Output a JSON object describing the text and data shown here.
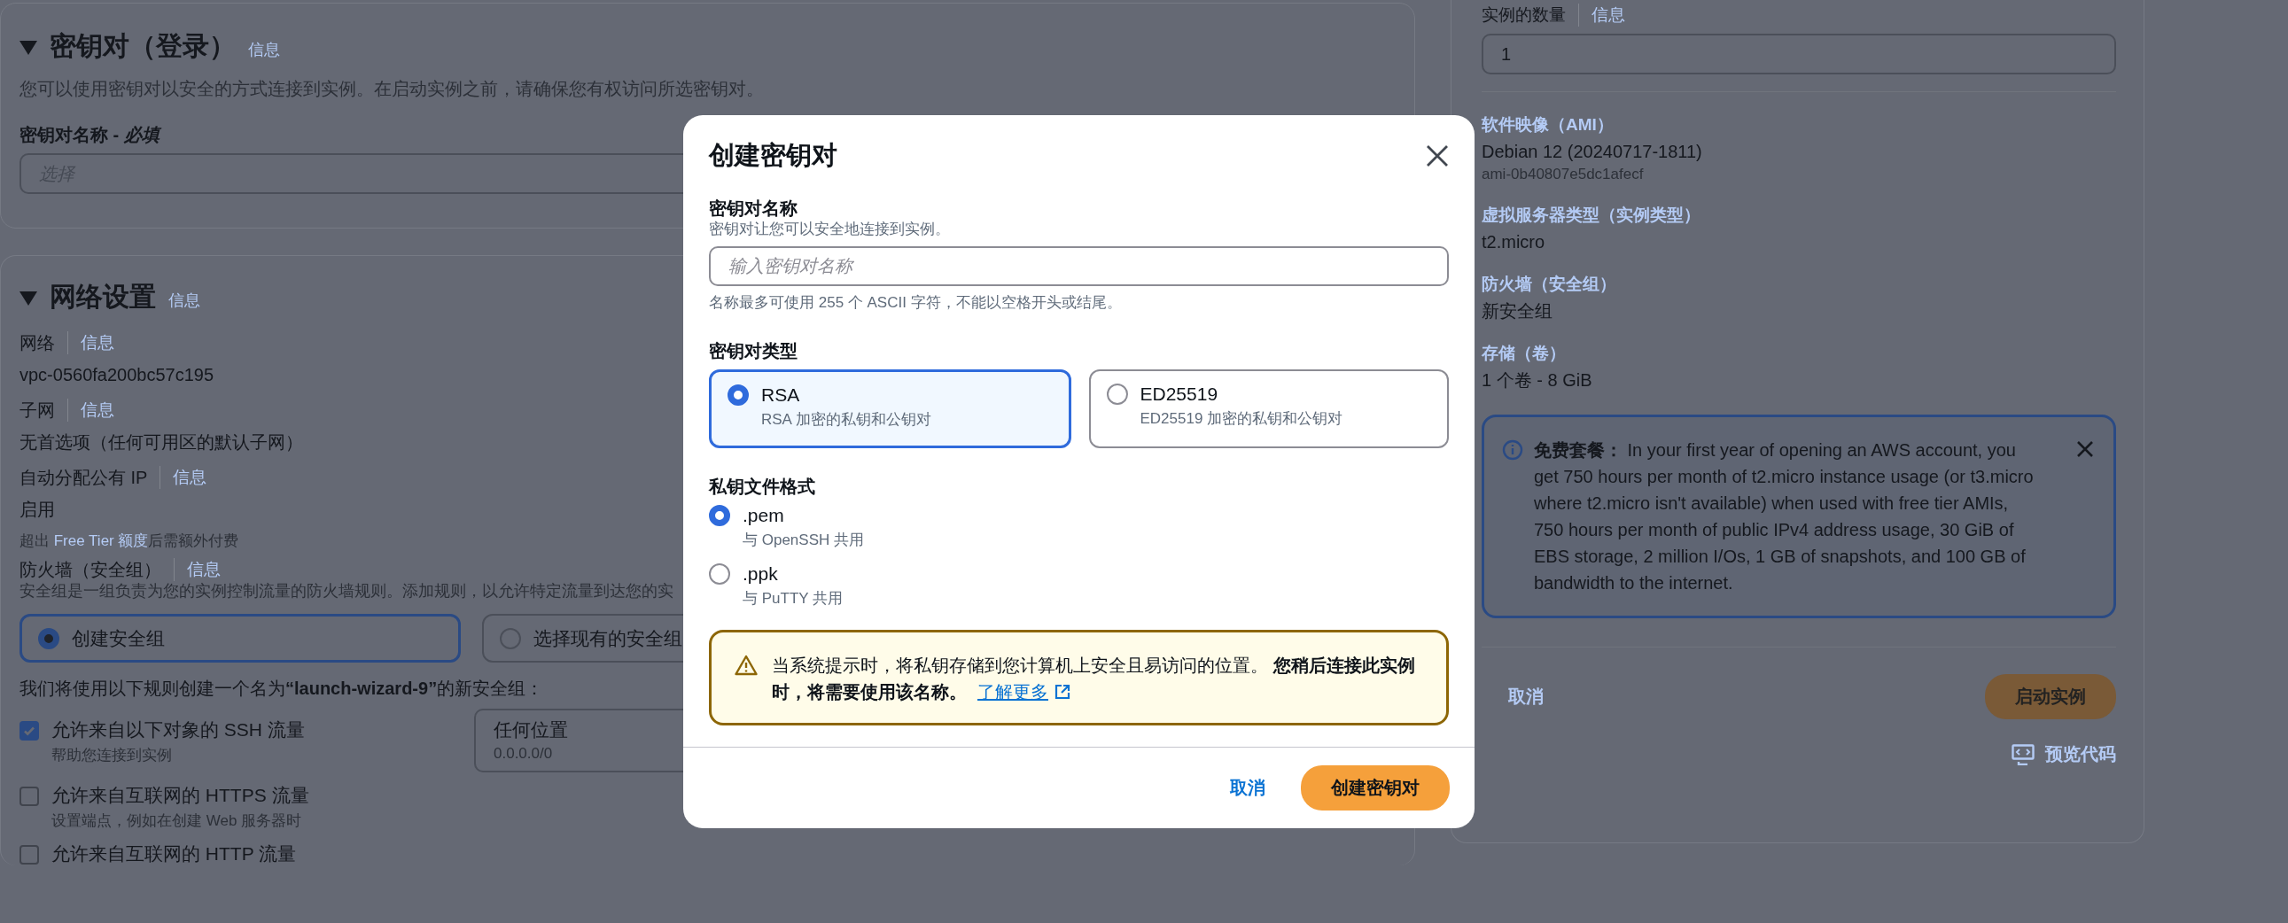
{
  "key_pair_section": {
    "title": "密钥对（登录）",
    "info_link": "信息",
    "description": "您可以使用密钥对以安全的方式连接到实例。在启动实例之前，请确保您有权访问所选密钥对。",
    "name_field": {
      "label": "密钥对名称 - ",
      "required": "必填",
      "placeholder": "选择"
    }
  },
  "network_section": {
    "title": "网络设置",
    "info_link": "信息",
    "fields": [
      {
        "label": "网络",
        "info_link": "信息",
        "value": "vpc-0560fa200bc57c195"
      },
      {
        "label": "子网",
        "info_link": "信息",
        "value": "无首选项（任何可用区的默认子网）"
      },
      {
        "label": "自动分配公有 IP",
        "info_link": "信息",
        "value": "启用"
      }
    ],
    "note": {
      "before": "超出 ",
      "link": "Free Tier 额度",
      "after": "后需额外付费"
    },
    "firewall": {
      "label": "防火墙（安全组）",
      "info_link": "信息",
      "description": "安全组是一组负责为您的实例控制流量的防火墙规则。添加规则，以允许特定流量到达您的实",
      "options": [
        {
          "label": "创建安全组",
          "selected": true
        },
        {
          "label": "选择现有的安全组",
          "selected": false
        }
      ],
      "rule_intro": "我们将使用以下规则创建一个名为**“launch-wizard-9”**的新安全组：",
      "rules": [
        {
          "label": "允许来自以下对象的 SSH 流量",
          "hint": "帮助您连接到实例",
          "checked": true,
          "source": {
            "value": "任何位置",
            "hint": "0.0.0.0/0"
          }
        },
        {
          "label": "允许来自互联网的 HTTPS 流量",
          "hint": "设置端点，例如在创建 Web 服务器时",
          "checked": false
        },
        {
          "label": "允许来自互联网的 HTTP 流量",
          "checked": false
        }
      ]
    }
  },
  "summary": {
    "instance_count": {
      "label": "实例的数量",
      "info_link": "信息",
      "value": "1"
    },
    "items": [
      {
        "label": "软件映像（AMI）",
        "value": "Debian 12 (20240717-1811)",
        "sub": "ami-0b40807e5dc1afecf"
      },
      {
        "label": "虚拟服务器类型（实例类型）",
        "value": "t2.micro"
      },
      {
        "label": "防火墙（安全组）",
        "value": "新安全组"
      },
      {
        "label": "存储（卷）",
        "value": "1 个卷 - 8 GiB"
      }
    ],
    "free_tier": {
      "title": "免费套餐：",
      "text": "In your first year of opening an AWS account, you get 750 hours per month of t2.micro instance usage (or t3.micro where t2.micro isn't available) when used with free tier AMIs, 750 hours per month of public IPv4 address usage, 30 GiB of EBS storage, 2 million I/Os, 1 GB of snapshots, and 100 GB of bandwidth to the internet."
    },
    "cancel": "取消",
    "launch": "启动实例",
    "preview": "预览代码"
  },
  "modal": {
    "title": "创建密钥对",
    "name": {
      "label": "密钥对名称",
      "description": "密钥对让您可以安全地连接到实例。",
      "placeholder": "输入密钥对名称",
      "constraint": "名称最多可使用 255 个 ASCII 字符，不能以空格开头或结尾。"
    },
    "type": {
      "label": "密钥对类型",
      "options": [
        {
          "label": "RSA",
          "description": "RSA 加密的私钥和公钥对",
          "selected": true
        },
        {
          "label": "ED25519",
          "description": "ED25519 加密的私钥和公钥对",
          "selected": false
        }
      ]
    },
    "format": {
      "label": "私钥文件格式",
      "options": [
        {
          "label": ".pem",
          "description": "与 OpenSSH 共用",
          "selected": true
        },
        {
          "label": ".ppk",
          "description": "与 PuTTY 共用",
          "selected": false
        }
      ]
    },
    "warning": {
      "text": "当系统提示时，将私钥存储到您计算机上安全且易访问的位置。 **您稍后连接此实例时，将需要使用该名称。**",
      "link": "了解更多"
    },
    "cancel": "取消",
    "create": "创建密钥对"
  }
}
